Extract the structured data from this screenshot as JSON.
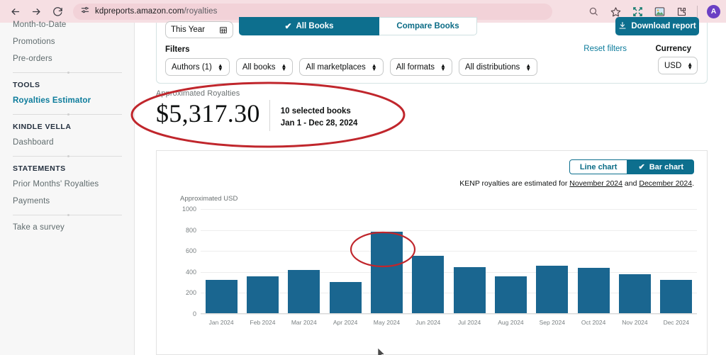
{
  "browser": {
    "back_icon": "back-arrow-icon",
    "forward_icon": "forward-arrow-icon",
    "reload_icon": "reload-icon",
    "site_settings_icon": "site-settings-icon",
    "url_domain": "kdpreports.amazon.com",
    "url_path": "/royalties",
    "zoom_icon": "search-zoom-icon",
    "bookmark_icon": "star-bookmark-icon",
    "fullscreen_icon": "expand-fullscreen-icon",
    "image_icon": "image-icon",
    "extensions_icon": "extensions-puzzle-icon",
    "avatar_initial": "A",
    "avatar_color": "#6b3fc4"
  },
  "sidebar": {
    "items_top": [
      {
        "label": "Month-to-Date",
        "active": false
      },
      {
        "label": "Promotions",
        "active": false
      },
      {
        "label": "Pre-orders",
        "active": false
      }
    ],
    "section_tools": "TOOLS",
    "items_tools": [
      {
        "label": "Royalties Estimator",
        "active": true
      }
    ],
    "section_vella": "KINDLE VELLA",
    "items_vella": [
      {
        "label": "Dashboard",
        "active": false
      }
    ],
    "section_statements": "STATEMENTS",
    "items_statements": [
      {
        "label": "Prior Months' Royalties",
        "active": false
      },
      {
        "label": "Payments",
        "active": false
      }
    ],
    "survey_label": "Take a survey"
  },
  "toolbar": {
    "date_range": "This Year",
    "calendar_icon": "calendar-icon",
    "tab_all_books": "All Books",
    "tab_compare_books": "Compare Books",
    "tab_selected": "All Books",
    "check_icon": "check-icon",
    "download_icon": "download-icon",
    "download_label": "Download report"
  },
  "filters": {
    "label": "Filters",
    "reset_label": "Reset filters",
    "currency_label": "Currency",
    "currency_value": "USD",
    "items": [
      {
        "label": "Authors (1)"
      },
      {
        "label": "All books"
      },
      {
        "label": "All marketplaces"
      },
      {
        "label": "All formats"
      },
      {
        "label": "All distributions"
      }
    ],
    "stepper_icon": "stepper-updown-icon"
  },
  "summary": {
    "label": "Approximated Royalties",
    "amount": "$5,317.30",
    "selected_books": "10 selected books",
    "date_range": "Jan 1 - Dec 28, 2024"
  },
  "chart_controls": {
    "line_chart_label": "Line chart",
    "bar_chart_label": "Bar chart",
    "selected": "Bar chart",
    "check_icon": "check-icon",
    "kenp_note_prefix": "KENP royalties are estimated for ",
    "kenp_month_1": "November 2024",
    "kenp_note_middle": " and ",
    "kenp_month_2": "December 2024",
    "kenp_note_suffix": "."
  },
  "chart_data": {
    "type": "bar",
    "title": "",
    "ylabel": "Approximated USD",
    "xlabel": "",
    "ylim": [
      0,
      1000
    ],
    "yticks": [
      0,
      200,
      400,
      600,
      800,
      1000
    ],
    "grid": true,
    "legend": "none",
    "bar_color": "#1a6690",
    "categories": [
      "Jan 2024",
      "Feb 2024",
      "Mar 2024",
      "Apr 2024",
      "May 2024",
      "Jun 2024",
      "Jul 2024",
      "Aug 2024",
      "Sep 2024",
      "Oct 2024",
      "Nov 2024",
      "Dec 2024"
    ],
    "values": [
      320,
      350,
      415,
      295,
      780,
      545,
      440,
      350,
      450,
      435,
      370,
      320
    ]
  },
  "annotations": [
    {
      "name": "royalties-total-highlight",
      "shape": "ellipse"
    },
    {
      "name": "may-bar-highlight",
      "shape": "ellipse"
    }
  ]
}
